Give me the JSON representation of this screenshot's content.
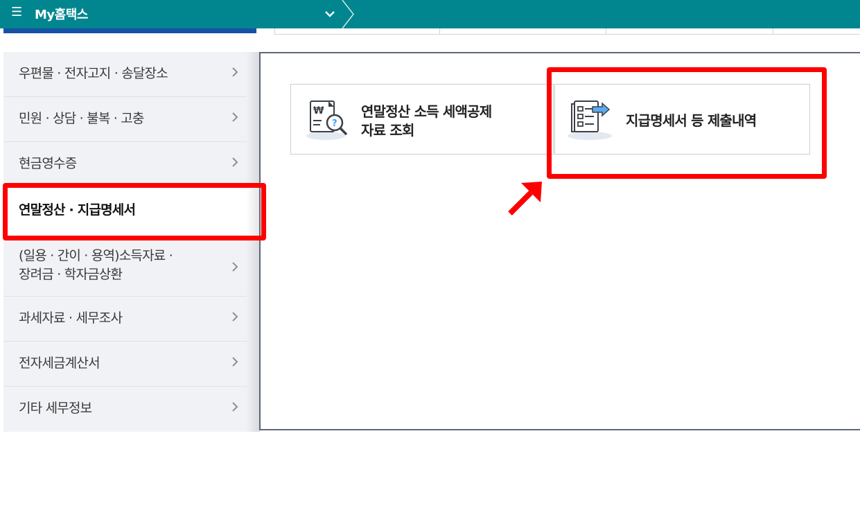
{
  "topbar": {
    "menu_icon": "☰",
    "title": "My홈택스"
  },
  "sidebar": {
    "items": [
      {
        "label": "우편물 · 전자고지 · 송달장소"
      },
      {
        "label": "민원 · 상담 · 불복 · 고충"
      },
      {
        "label": "현금영수증"
      },
      {
        "label": "연말정산 · 지급명세서"
      },
      {
        "label_line1": "(일용 · 간이 · 용역)소득자료 ·",
        "label_line2": "장려금 · 학자금상환"
      },
      {
        "label": "과세자료 · 세무조사"
      },
      {
        "label": "전자세금계산서"
      },
      {
        "label": "기타 세무정보"
      }
    ]
  },
  "cards": [
    {
      "line1": "연말정산 소득 세액공제",
      "line2": "자료 조회",
      "icon": "document-search-icon"
    },
    {
      "label": "지급명세서 등 제출내역",
      "icon": "document-submit-icon"
    }
  ],
  "colors": {
    "topbar": "#01868f",
    "highlight": "#ff0000",
    "accent_blue": "#1552a6"
  }
}
